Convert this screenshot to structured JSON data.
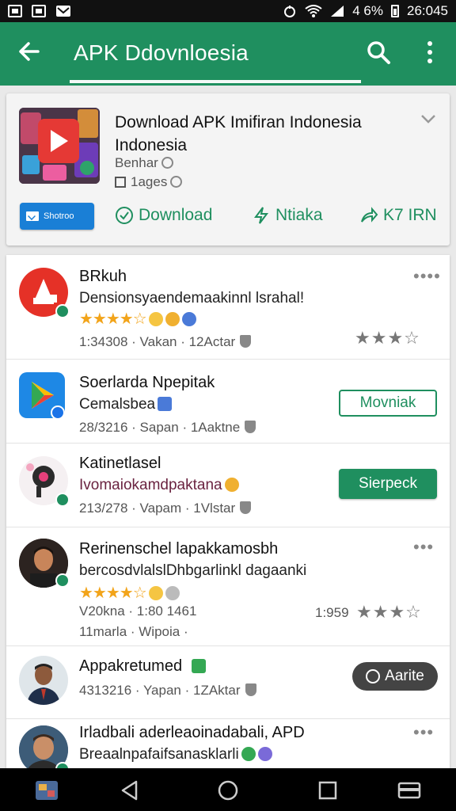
{
  "status_bar": {
    "battery_text": "4 6%",
    "time": "26:045"
  },
  "toolbar": {
    "title": "APK Ddovnloesia"
  },
  "featured": {
    "name": "Download APK Imifiran Indonesia Indonesia",
    "developer": "Benhar",
    "pages": "1ages",
    "share_label": "Shotroo",
    "download_label": "Download",
    "action2_label": "Ntiaka",
    "action3_label": "K7 IRN"
  },
  "list": {
    "rows": [
      {
        "title": "BRkuh",
        "subtitle": "Densionsyaendemaakinnl lsrahal!",
        "meta": "1:34308 · Vakan · 12Actar",
        "stars": "★★★★☆",
        "gray_stars": "★★★☆"
      },
      {
        "title": "Soerlarda Npepitak",
        "subtitle": "Cemalsbea",
        "meta": "28/3216 · Sapan · 1Aaktne",
        "button": "Movniak"
      },
      {
        "title": "Katinetlasel",
        "subtitle": "Ivomaiokamdpaktana",
        "meta": "213/278 · Vapam · 1Vlstar",
        "button": "Sierpeck"
      },
      {
        "title": "Rerinenschel lapakkamosbh",
        "subtitle": "bercosdvlalslDhbgarlinkl dagaanki",
        "stars": "★★★★☆",
        "meta": "V20kna · 1:80 1461",
        "meta2": "11marla · Wipoia ·",
        "rating_num": "1:959",
        "gray_stars": "★★★☆"
      },
      {
        "title": "Appakretumed",
        "meta": "4313216 · Yapan · 1ZAktar",
        "button": "Aarite"
      },
      {
        "title": "Irladbali aderleaoinadabali, APD",
        "subtitle": "Breaalnpafaifsanasklarli"
      }
    ]
  },
  "colors": {
    "primary": "#1f8f5f",
    "share_blue": "#1a7fd6",
    "star": "#f2a41a"
  }
}
